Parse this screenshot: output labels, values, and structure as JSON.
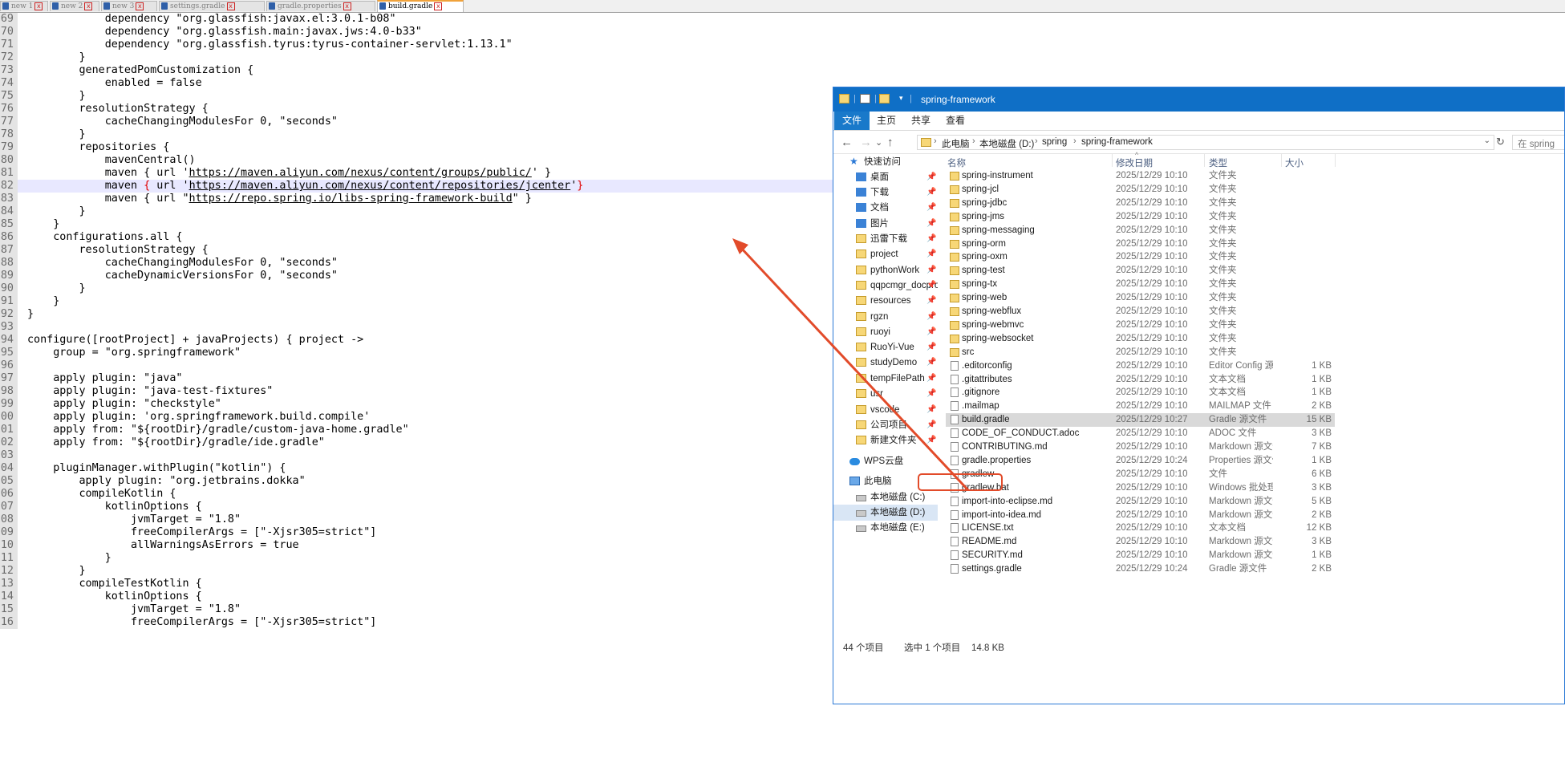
{
  "tabs": [
    {
      "label": "new 1",
      "close": "x",
      "active": false
    },
    {
      "label": "new 2",
      "close": "x",
      "active": false
    },
    {
      "label": "new 3",
      "close": "x",
      "active": false
    },
    {
      "label": "settings.gradle",
      "close": "x",
      "active": false
    },
    {
      "label": "gradle.properties",
      "close": "x",
      "active": false
    },
    {
      "label": "build.gradle",
      "close": "x",
      "active": true
    }
  ],
  "editor": {
    "lines": [
      {
        "n": "69",
        "code": "            dependency \"org.glassfish:javax.el:3.0.1-b08\""
      },
      {
        "n": "70",
        "code": "            dependency \"org.glassfish.main:javax.jws:4.0-b33\""
      },
      {
        "n": "71",
        "code": "            dependency \"org.glassfish.tyrus:tyrus-container-servlet:1.13.1\""
      },
      {
        "n": "72",
        "code": "        }"
      },
      {
        "n": "73",
        "code": "        generatedPomCustomization {"
      },
      {
        "n": "74",
        "code": "            enabled = false"
      },
      {
        "n": "75",
        "code": "        }"
      },
      {
        "n": "76",
        "code": "        resolutionStrategy {"
      },
      {
        "n": "77",
        "code": "            cacheChangingModulesFor 0, \"seconds\""
      },
      {
        "n": "78",
        "code": "        }"
      },
      {
        "n": "79",
        "code": "        repositories {"
      },
      {
        "n": "80",
        "code": "            mavenCentral()"
      },
      {
        "n": "81",
        "pre": "            maven { url '",
        "url": "https://maven.aliyun.com/nexus/content/groups/public/",
        "post": "' }"
      },
      {
        "n": "82",
        "pre": "            maven ",
        "brace1": "{",
        "mid": " url '",
        "url": "https://maven.aliyun.com/nexus/content/repositories/jcenter",
        "post": "'",
        "brace2": "}",
        "hl": true
      },
      {
        "n": "83",
        "pre": "            maven { url \"",
        "url": "https://repo.spring.io/libs-spring-framework-build",
        "post": "\" }"
      },
      {
        "n": "84",
        "code": "        }"
      },
      {
        "n": "85",
        "code": "    }"
      },
      {
        "n": "86",
        "code": "    configurations.all {"
      },
      {
        "n": "87",
        "code": "        resolutionStrategy {"
      },
      {
        "n": "88",
        "code": "            cacheChangingModulesFor 0, \"seconds\""
      },
      {
        "n": "89",
        "code": "            cacheDynamicVersionsFor 0, \"seconds\""
      },
      {
        "n": "90",
        "code": "        }"
      },
      {
        "n": "91",
        "code": "    }"
      },
      {
        "n": "92",
        "code": "}"
      },
      {
        "n": "93",
        "code": ""
      },
      {
        "n": "94",
        "code": "configure([rootProject] + javaProjects) { project ->"
      },
      {
        "n": "95",
        "code": "    group = \"org.springframework\""
      },
      {
        "n": "96",
        "code": ""
      },
      {
        "n": "97",
        "code": "    apply plugin: \"java\""
      },
      {
        "n": "98",
        "code": "    apply plugin: \"java-test-fixtures\""
      },
      {
        "n": "99",
        "code": "    apply plugin: \"checkstyle\""
      },
      {
        "n": "00",
        "code": "    apply plugin: 'org.springframework.build.compile'"
      },
      {
        "n": "01",
        "code": "    apply from: \"${rootDir}/gradle/custom-java-home.gradle\""
      },
      {
        "n": "02",
        "code": "    apply from: \"${rootDir}/gradle/ide.gradle\""
      },
      {
        "n": "03",
        "code": ""
      },
      {
        "n": "04",
        "code": "    pluginManager.withPlugin(\"kotlin\") {"
      },
      {
        "n": "05",
        "code": "        apply plugin: \"org.jetbrains.dokka\""
      },
      {
        "n": "06",
        "code": "        compileKotlin {"
      },
      {
        "n": "07",
        "code": "            kotlinOptions {"
      },
      {
        "n": "08",
        "code": "                jvmTarget = \"1.8\""
      },
      {
        "n": "09",
        "code": "                freeCompilerArgs = [\"-Xjsr305=strict\"]"
      },
      {
        "n": "10",
        "code": "                allWarningsAsErrors = true"
      },
      {
        "n": "11",
        "code": "            }"
      },
      {
        "n": "12",
        "code": "        }"
      },
      {
        "n": "13",
        "code": "        compileTestKotlin {"
      },
      {
        "n": "14",
        "code": "            kotlinOptions {"
      },
      {
        "n": "15",
        "code": "                jvmTarget = \"1.8\""
      },
      {
        "n": "16",
        "code": "                freeCompilerArgs = [\"-Xjsr305=strict\"]"
      }
    ]
  },
  "explorer": {
    "title": "spring-framework",
    "title_sep": "|",
    "qa_dropdown": "▾",
    "ribbon_tabs": [
      "文件",
      "主页",
      "共享",
      "查看"
    ],
    "nav_back": "←",
    "nav_forward": "→",
    "nav_recent": "⌄",
    "nav_up": "↑",
    "breadcrumb": [
      "此电脑",
      "本地磁盘 (D:)",
      "spring",
      "spring-framework"
    ],
    "crumb_sep": "›",
    "addr_dropdown": "⌄",
    "refresh": "↻",
    "search_placeholder": "在 spring",
    "pin": "📌",
    "nav_items": [
      {
        "label": "快速访问",
        "icon": "star",
        "indent": 20,
        "pinned": false
      },
      {
        "label": "桌面",
        "icon": "blue",
        "indent": 28,
        "pinned": true
      },
      {
        "label": "下载",
        "icon": "blue",
        "indent": 28,
        "pinned": true
      },
      {
        "label": "文档",
        "icon": "blue",
        "indent": 28,
        "pinned": true
      },
      {
        "label": "图片",
        "icon": "blue",
        "indent": 28,
        "pinned": true
      },
      {
        "label": "迅雷下载",
        "icon": "folder",
        "indent": 28,
        "pinned": true
      },
      {
        "label": "project",
        "icon": "folder",
        "indent": 28,
        "pinned": true
      },
      {
        "label": "pythonWork",
        "icon": "folder",
        "indent": 28,
        "pinned": true
      },
      {
        "label": "qqpcmgr_docpro",
        "icon": "folder",
        "indent": 28,
        "pinned": true
      },
      {
        "label": "resources",
        "icon": "folder",
        "indent": 28,
        "pinned": true
      },
      {
        "label": "rgzn",
        "icon": "folder",
        "indent": 28,
        "pinned": true
      },
      {
        "label": "ruoyi",
        "icon": "folder",
        "indent": 28,
        "pinned": true
      },
      {
        "label": "RuoYi-Vue",
        "icon": "folder",
        "indent": 28,
        "pinned": true
      },
      {
        "label": "studyDemo",
        "icon": "folder",
        "indent": 28,
        "pinned": true
      },
      {
        "label": "tempFilePath",
        "icon": "folder",
        "indent": 28,
        "pinned": true
      },
      {
        "label": "usr",
        "icon": "folder",
        "indent": 28,
        "pinned": true
      },
      {
        "label": "vscode",
        "icon": "folder",
        "indent": 28,
        "pinned": true
      },
      {
        "label": "公司项目",
        "icon": "folder",
        "indent": 28,
        "pinned": true
      },
      {
        "label": "新建文件夹",
        "icon": "folder",
        "indent": 28,
        "pinned": true
      },
      {
        "label": "",
        "icon": "none",
        "indent": 0,
        "pinned": false
      },
      {
        "label": "WPS云盘",
        "icon": "cloud",
        "indent": 20,
        "pinned": false
      },
      {
        "label": "",
        "icon": "none",
        "indent": 0,
        "pinned": false
      },
      {
        "label": "此电脑",
        "icon": "pc",
        "indent": 20,
        "pinned": false
      },
      {
        "label": "本地磁盘 (C:)",
        "icon": "drive",
        "indent": 28,
        "pinned": false
      },
      {
        "label": "本地磁盘 (D:)",
        "icon": "drive",
        "indent": 28,
        "pinned": false,
        "selected": true
      },
      {
        "label": "本地磁盘 (E:)",
        "icon": "drive",
        "indent": 28,
        "pinned": false
      }
    ],
    "columns": {
      "name": "名称",
      "date": "修改日期",
      "type": "类型",
      "size": "大小",
      "sort_indicator": "^"
    },
    "files": [
      {
        "name": "spring-instrument",
        "date": "2025/12/29 10:10",
        "type": "文件夹",
        "size": "",
        "kind": "folder"
      },
      {
        "name": "spring-jcl",
        "date": "2025/12/29 10:10",
        "type": "文件夹",
        "size": "",
        "kind": "folder"
      },
      {
        "name": "spring-jdbc",
        "date": "2025/12/29 10:10",
        "type": "文件夹",
        "size": "",
        "kind": "folder"
      },
      {
        "name": "spring-jms",
        "date": "2025/12/29 10:10",
        "type": "文件夹",
        "size": "",
        "kind": "folder"
      },
      {
        "name": "spring-messaging",
        "date": "2025/12/29 10:10",
        "type": "文件夹",
        "size": "",
        "kind": "folder"
      },
      {
        "name": "spring-orm",
        "date": "2025/12/29 10:10",
        "type": "文件夹",
        "size": "",
        "kind": "folder"
      },
      {
        "name": "spring-oxm",
        "date": "2025/12/29 10:10",
        "type": "文件夹",
        "size": "",
        "kind": "folder"
      },
      {
        "name": "spring-test",
        "date": "2025/12/29 10:10",
        "type": "文件夹",
        "size": "",
        "kind": "folder"
      },
      {
        "name": "spring-tx",
        "date": "2025/12/29 10:10",
        "type": "文件夹",
        "size": "",
        "kind": "folder"
      },
      {
        "name": "spring-web",
        "date": "2025/12/29 10:10",
        "type": "文件夹",
        "size": "",
        "kind": "folder"
      },
      {
        "name": "spring-webflux",
        "date": "2025/12/29 10:10",
        "type": "文件夹",
        "size": "",
        "kind": "folder"
      },
      {
        "name": "spring-webmvc",
        "date": "2025/12/29 10:10",
        "type": "文件夹",
        "size": "",
        "kind": "folder"
      },
      {
        "name": "spring-websocket",
        "date": "2025/12/29 10:10",
        "type": "文件夹",
        "size": "",
        "kind": "folder"
      },
      {
        "name": "src",
        "date": "2025/12/29 10:10",
        "type": "文件夹",
        "size": "",
        "kind": "folder"
      },
      {
        "name": ".editorconfig",
        "date": "2025/12/29 10:10",
        "type": "Editor Config 源...",
        "size": "1 KB",
        "kind": "file"
      },
      {
        "name": ".gitattributes",
        "date": "2025/12/29 10:10",
        "type": "文本文档",
        "size": "1 KB",
        "kind": "file"
      },
      {
        "name": ".gitignore",
        "date": "2025/12/29 10:10",
        "type": "文本文档",
        "size": "1 KB",
        "kind": "file"
      },
      {
        "name": ".mailmap",
        "date": "2025/12/29 10:10",
        "type": "MAILMAP 文件",
        "size": "2 KB",
        "kind": "file"
      },
      {
        "name": "build.gradle",
        "date": "2025/12/29 10:27",
        "type": "Gradle 源文件",
        "size": "15 KB",
        "kind": "file",
        "selected": true
      },
      {
        "name": "CODE_OF_CONDUCT.adoc",
        "date": "2025/12/29 10:10",
        "type": "ADOC 文件",
        "size": "3 KB",
        "kind": "file"
      },
      {
        "name": "CONTRIBUTING.md",
        "date": "2025/12/29 10:10",
        "type": "Markdown 源文件",
        "size": "7 KB",
        "kind": "file"
      },
      {
        "name": "gradle.properties",
        "date": "2025/12/29 10:24",
        "type": "Properties 源文件",
        "size": "1 KB",
        "kind": "file"
      },
      {
        "name": "gradlew",
        "date": "2025/12/29 10:10",
        "type": "文件",
        "size": "6 KB",
        "kind": "file"
      },
      {
        "name": "gradlew.bat",
        "date": "2025/12/29 10:10",
        "type": "Windows 批处理...",
        "size": "3 KB",
        "kind": "file"
      },
      {
        "name": "import-into-eclipse.md",
        "date": "2025/12/29 10:10",
        "type": "Markdown 源文件",
        "size": "5 KB",
        "kind": "file"
      },
      {
        "name": "import-into-idea.md",
        "date": "2025/12/29 10:10",
        "type": "Markdown 源文件",
        "size": "2 KB",
        "kind": "file"
      },
      {
        "name": "LICENSE.txt",
        "date": "2025/12/29 10:10",
        "type": "文本文档",
        "size": "12 KB",
        "kind": "file"
      },
      {
        "name": "README.md",
        "date": "2025/12/29 10:10",
        "type": "Markdown 源文件",
        "size": "3 KB",
        "kind": "file"
      },
      {
        "name": "SECURITY.md",
        "date": "2025/12/29 10:10",
        "type": "Markdown 源文件",
        "size": "1 KB",
        "kind": "file"
      },
      {
        "name": "settings.gradle",
        "date": "2025/12/29 10:24",
        "type": "Gradle 源文件",
        "size": "2 KB",
        "kind": "file"
      }
    ],
    "status": {
      "count": "44 个项目",
      "selected": "选中 1 个项目",
      "size": "14.8 KB"
    }
  },
  "colors": {
    "annotation_red": "#e24b2a",
    "title_blue": "#0f6fc6"
  }
}
